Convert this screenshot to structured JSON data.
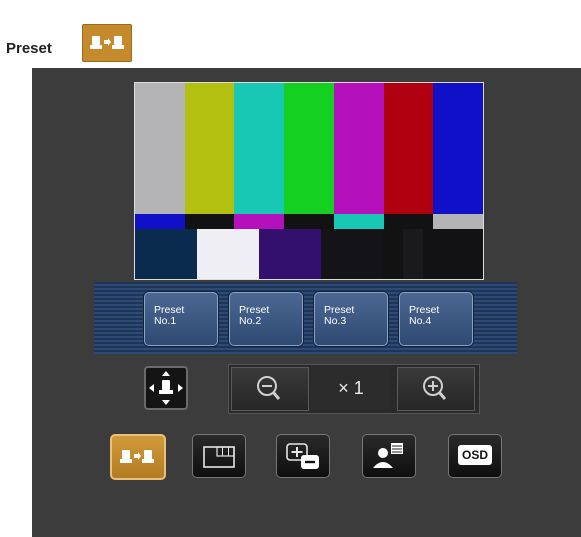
{
  "heading": {
    "title": "Preset"
  },
  "monitor": {
    "top_bars": [
      "#b4b4b6",
      "#b4c010",
      "#18c8b4",
      "#14d020",
      "#b410bc",
      "#b00010",
      "#1010c8"
    ],
    "mid_bars": [
      "#1010c8",
      "#121212",
      "#b410bc",
      "#121212",
      "#18c8b4",
      "#121212",
      "#b4b4b6"
    ],
    "bottom_bars": [
      "#0a2a4e",
      "#eeeef4",
      "#34106e",
      "#141418",
      "#121212",
      "#1a1a1c",
      "#121214"
    ]
  },
  "presets": [
    {
      "line1": "Preset",
      "line2": "No.1"
    },
    {
      "line1": "Preset",
      "line2": "No.2"
    },
    {
      "line1": "Preset",
      "line2": "No.3"
    },
    {
      "line1": "Preset",
      "line2": "No.4"
    }
  ],
  "zoom": {
    "readout": "× 1"
  },
  "toolbar": {
    "osd_label": "OSD"
  },
  "colors": {
    "accent": "#c58a2c",
    "panel_bg": "#3c3c3c",
    "preset_strip": "#1e3558"
  }
}
